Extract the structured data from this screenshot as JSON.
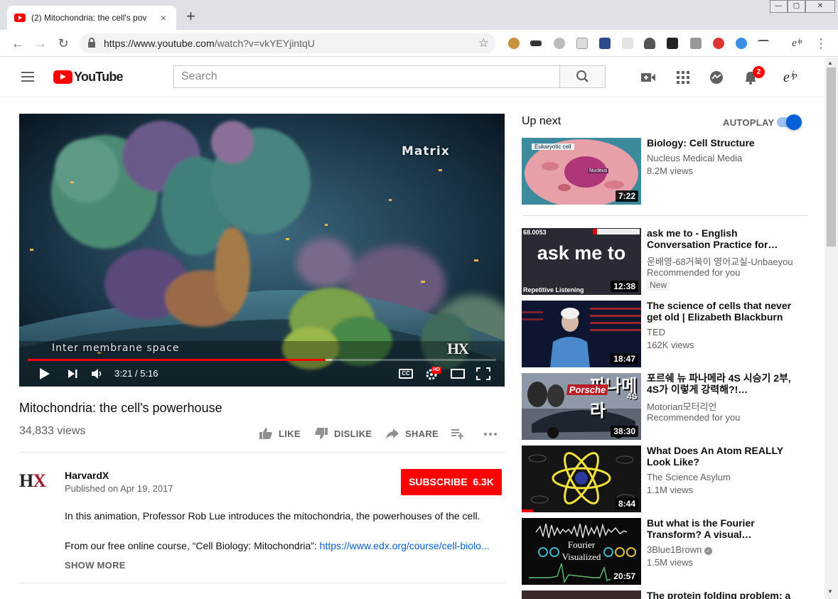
{
  "browser": {
    "tab_title": "(2) Mitochondria: the cell's pov",
    "tab_close": "×",
    "new_tab": "+",
    "url_host": "https://www.youtube.com",
    "url_path": "/watch?v=vkYEYjintqU",
    "back": "←",
    "forward": "→",
    "reload": "↻",
    "star": "☆",
    "menu": "⋮",
    "profile": "eⁱᵖ",
    "win_minimize": "—",
    "win_restore": "▢",
    "win_close": "✕"
  },
  "masthead": {
    "logo_text": "YouTube",
    "search_placeholder": "Search",
    "notification_count": "2",
    "avatar_text": "eⁱᵖ"
  },
  "player": {
    "overlay_matrix": "Matrix",
    "overlay_intermembrane": "Inter membrane space",
    "watermark": "HX",
    "time": "3:21 / 5:16",
    "progress": 0.636,
    "buffered": 0.65,
    "cc_label": "CC",
    "hd_label": "HD"
  },
  "video": {
    "title": "Mitochondria: the cell's powerhouse",
    "views": "34,833 views",
    "like": "LIKE",
    "dislike": "DISLIKE",
    "share": "SHARE"
  },
  "channel": {
    "name": "HarvardX",
    "published": "Published on Apr 19, 2017",
    "subscribe": "SUBSCRIBE",
    "subscribers": "6.3K",
    "logo_h": "H",
    "logo_x": "X"
  },
  "description": {
    "line1": "In this animation, Professor Rob Lue introduces the mitochondria, the powerhouses of the cell.",
    "line2_prefix": "From our free online course, “Cell Biology: Mitochondria”: ",
    "line2_link": "https://www.edx.org/course/cell-biolo...",
    "show_more": "SHOW MORE"
  },
  "sidebar": {
    "up_next": "Up next",
    "autoplay": "AUTOPLAY",
    "autoplay_on": true,
    "items": [
      {
        "title": "Biology: Cell Structure",
        "channel": "Nucleus Medical Media",
        "meta": "8.2M views",
        "duration": "7:22",
        "thumb_label": "Eukaryotic cell",
        "thumb_label2": "Nucleus"
      },
      {
        "title": "ask me to - English Conversation Practice for…",
        "channel": "운배영-68거북이 영어교실-Unbaeyoung",
        "meta": "Recommended for you",
        "badge": "New",
        "duration": "12:38",
        "thumb_big": "ask me to",
        "thumb_corner": "68.0053",
        "thumb_bottom": "Repetitive Listening"
      },
      {
        "title": "The science of cells that never get old | Elizabeth Blackburn",
        "channel": "TED",
        "meta": "162K views",
        "duration": "18:47"
      },
      {
        "title": "포르쉐 뉴 파나메라 4S 시승기 2부, 4S가 이렇게 강력해?!…",
        "channel": "Motorian모터리언",
        "meta": "Recommended for you",
        "duration": "38:30",
        "thumb_big": "파나메라",
        "thumb_sub": "Porsche",
        "thumb_4s": "4S"
      },
      {
        "title": "What Does An Atom REALLY Look Like?",
        "channel": "The Science Asylum",
        "meta": "1.1M views",
        "duration": "8:44"
      },
      {
        "title": "But what is the Fourier Transform? A visual…",
        "channel": "3Blue1Brown",
        "meta": "1.5M views",
        "duration": "20:57",
        "thumb_big": "Fourier",
        "thumb_sub": "Visualized"
      },
      {
        "title": "The protein folding problem: a"
      }
    ]
  },
  "colors": {
    "brand_red": "#ff0000",
    "link_blue": "#065fd4",
    "text_secondary": "#606060"
  }
}
